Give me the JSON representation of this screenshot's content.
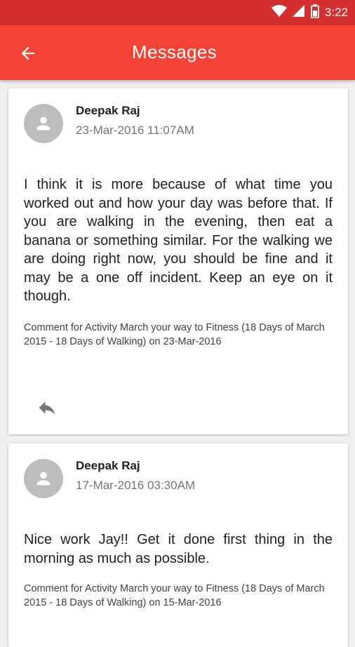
{
  "status_bar": {
    "time": "3:22",
    "icons": [
      "wifi-icon",
      "signal-icon",
      "battery-icon"
    ]
  },
  "app_bar": {
    "title": "Messages",
    "back_icon": "arrow-back-icon"
  },
  "colors": {
    "status_bar": "#d32f2f",
    "app_bar": "#f44336",
    "avatar": "#bdbdbd"
  },
  "messages": [
    {
      "author": "Deepak Raj",
      "date": "23-Mar-2016 11:07AM",
      "body": "I think it is more because of what time you worked out and how your day was before that. If you are walking in the evening, then eat a banana or something similar. For the walking we are doing right now, you should be fine and it may be a one off incident. Keep an eye on it though.",
      "meta": "Comment for Activity March your way to Fitness (18 Days of March 2015 - 18 Days of Walking) on 23-Mar-2016",
      "reply_icon": "reply-icon"
    },
    {
      "author": "Deepak Raj",
      "date": "17-Mar-2016 03:30AM",
      "body": "Nice work Jay!! Get it done first thing in the morning as much as possible.",
      "meta": "Comment for Activity March your way to Fitness (18 Days of March 2015 - 18 Days of Walking) on 15-Mar-2016"
    }
  ]
}
